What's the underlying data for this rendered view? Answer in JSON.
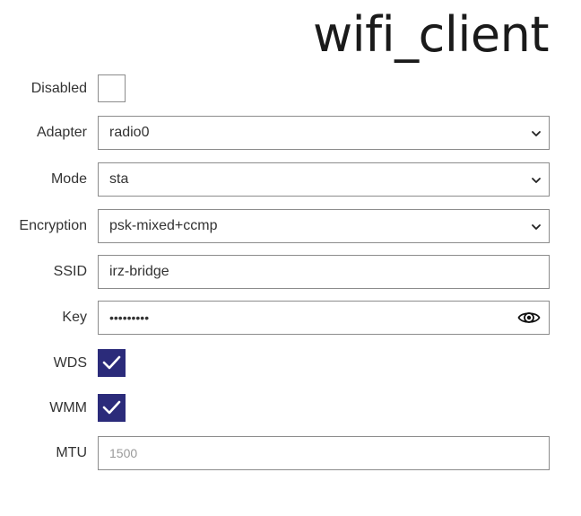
{
  "header": {
    "title": "wifi_client"
  },
  "form": {
    "disabled": {
      "label": "Disabled",
      "checked": false
    },
    "adapter": {
      "label": "Adapter",
      "value": "radio0",
      "icon": "chevron-down-icon"
    },
    "mode": {
      "label": "Mode",
      "value": "sta",
      "icon": "chevron-down-icon"
    },
    "encryption": {
      "label": "Encryption",
      "value": "psk-mixed+ccmp",
      "icon": "chevron-down-icon"
    },
    "ssid": {
      "label": "SSID",
      "value": "irz-bridge"
    },
    "key": {
      "label": "Key",
      "value": "•••••••••",
      "icon": "eye-icon"
    },
    "wds": {
      "label": "WDS",
      "checked": true
    },
    "wmm": {
      "label": "WMM",
      "checked": true
    },
    "mtu": {
      "label": "MTU",
      "placeholder": "1500"
    }
  },
  "colors": {
    "checkbox_checked": "#2b2b7a",
    "border": "#8c8c8c",
    "text": "#333333",
    "placeholder": "#9a9a9a"
  }
}
